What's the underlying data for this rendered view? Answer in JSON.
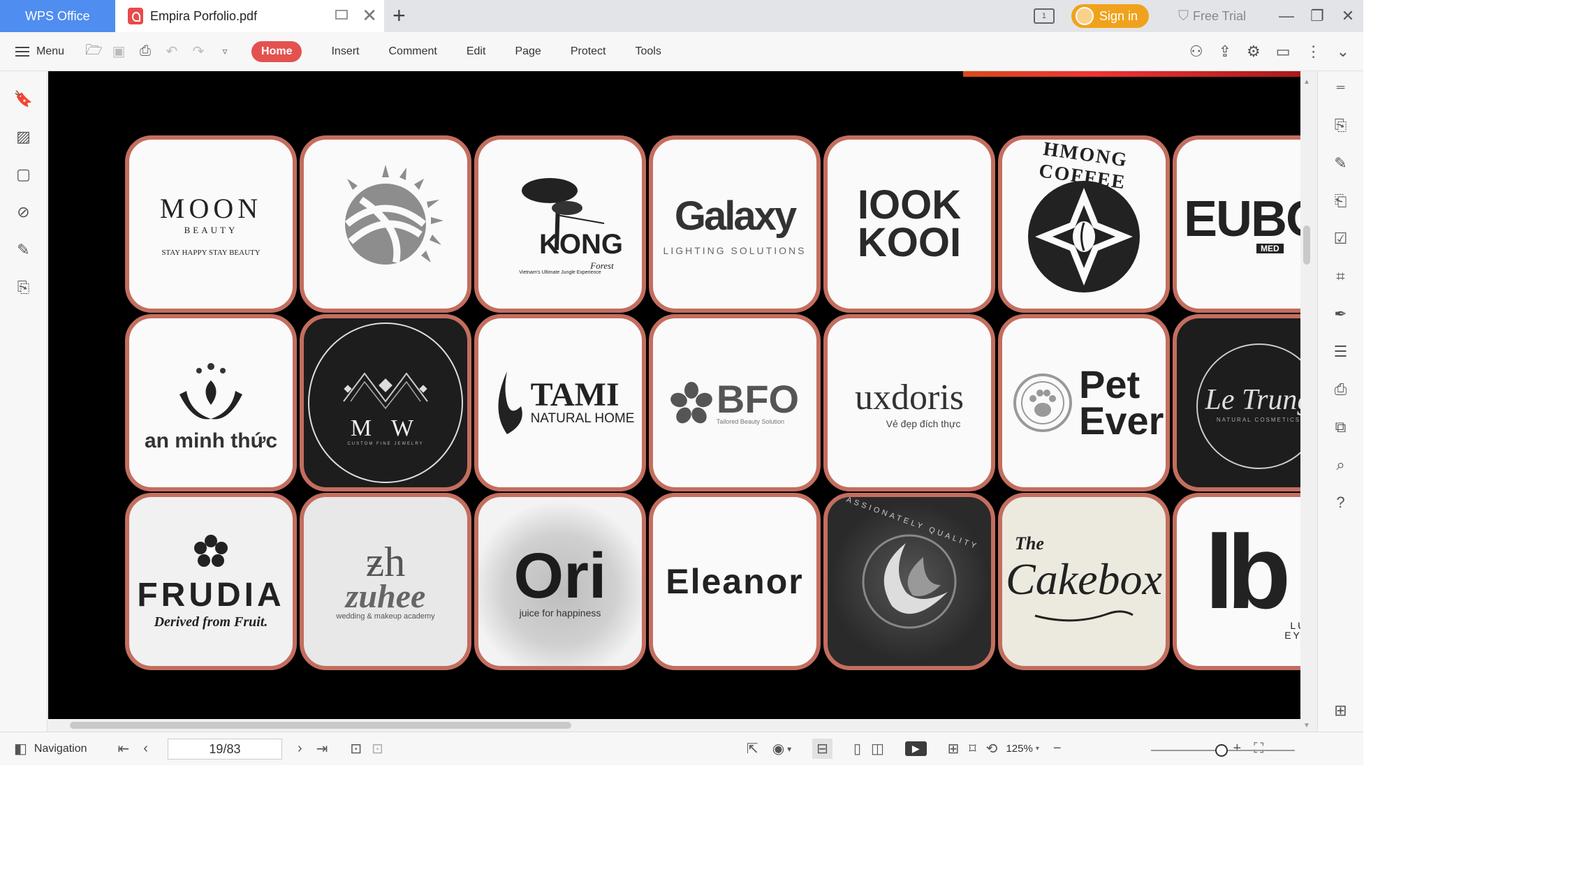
{
  "app": {
    "name": "WPS Office"
  },
  "document_tab": {
    "title": "Empira Porfolio.pdf"
  },
  "titlebar": {
    "sign_in": "Sign in",
    "free_trial": "Free Trial",
    "window_badge": "1"
  },
  "toolbar": {
    "menu_label": "Menu",
    "tabs": [
      "Home",
      "Insert",
      "Comment",
      "Edit",
      "Page",
      "Protect",
      "Tools"
    ],
    "active_tab": "Home"
  },
  "logos": {
    "row1": [
      {
        "name": "MOON",
        "sub": "BEAUTY",
        "tagline": "STAY HAPPY STAY BEAUTY"
      },
      {
        "name": "",
        "sub": "",
        "tagline": ""
      },
      {
        "name": "KONG",
        "sub": "Forest",
        "tagline": "Vietnam's Ultimate Jungle Experience"
      },
      {
        "name": "Galaxy",
        "sub": "LIGHTING SOLUTIONS",
        "tagline": ""
      },
      {
        "name": "IOOK KOOI",
        "sub": "",
        "tagline": ""
      },
      {
        "name": "HMONG COFFEE",
        "sub": "",
        "tagline": ""
      },
      {
        "name": "EUBOS",
        "sub": "MED",
        "tagline": ""
      }
    ],
    "row2": [
      {
        "name": "an minh thức",
        "sub": ""
      },
      {
        "name": "M W",
        "sub": "CUSTOM FINE JEWELRY"
      },
      {
        "name": "TAMI",
        "sub": "NATURAL HOME"
      },
      {
        "name": "BFO",
        "sub": "Tailored Beauty Solution"
      },
      {
        "name": "uxdoris",
        "sub": "Vẻ đẹp đích thực"
      },
      {
        "name": "Pet Ever",
        "sub": ""
      },
      {
        "name": "Le Trung",
        "sub": "NATURAL COSMETICS"
      }
    ],
    "row3": [
      {
        "name": "FRUDIA",
        "sub": "Derived from Fruit."
      },
      {
        "name": "zuhee",
        "sub": "wedding & makeup academy"
      },
      {
        "name": "Ori",
        "sub": "juice for happiness"
      },
      {
        "name": "Eleanor",
        "sub": ""
      },
      {
        "name": "PASSIONATELY QUALITY",
        "sub": ""
      },
      {
        "name": "Cakebox",
        "sub": "The"
      },
      {
        "name": "lb",
        "sub": "LUXU EYEWE"
      }
    ]
  },
  "statusbar": {
    "navigation": "Navigation",
    "page": "19/83",
    "zoom": "125%"
  },
  "colors": {
    "accent": "#e3524f",
    "brand": "#4f8df0",
    "card_border": "#c36e5f",
    "signin": "#f1a21c"
  }
}
